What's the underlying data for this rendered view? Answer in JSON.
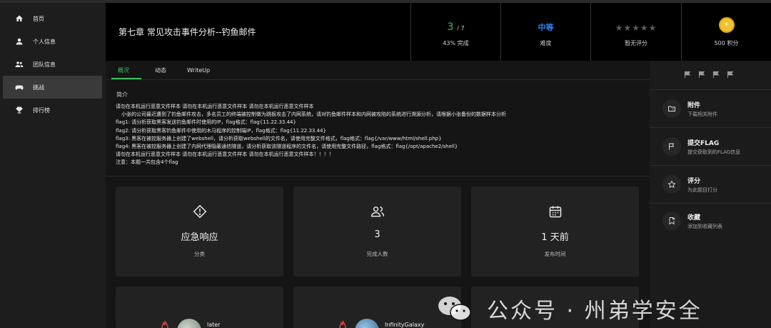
{
  "sidebar": {
    "items": [
      {
        "label": "首页",
        "icon": "home-icon"
      },
      {
        "label": "个人信息",
        "icon": "person-icon"
      },
      {
        "label": "团队信息",
        "icon": "group-icon"
      },
      {
        "label": "挑战",
        "icon": "gamepad-icon",
        "active": true
      },
      {
        "label": "排行榜",
        "icon": "trophy-icon"
      }
    ]
  },
  "header": {
    "title": "第七章 常见攻击事件分析--钓鱼邮件",
    "progress": {
      "solved": "3",
      "total": "/ 7",
      "label": "43% 完成"
    },
    "difficulty": {
      "value": "中等",
      "label": "难度"
    },
    "rating": {
      "stars": "★★★★★",
      "label": "暂无评分",
      "filled": 0
    },
    "points": {
      "label": "500 积分"
    }
  },
  "tabs": [
    "概况",
    "动态",
    "WriteUp"
  ],
  "description": {
    "title": "简介",
    "lines": [
      "请勿在本机运行恶意文件样本 请勿在本机运行恶意文件样本 请勿在本机运行恶意文件样本",
      "小张的公司最近遭到了钓鱼邮件攻击，多名员工的终端被控制做为跳板攻击了内网系统，请对钓鱼邮件样本和内网被攻陷的系统进行溯源分析，请根据小张备份的数据样本分析",
      "flag1: 请分析获取黑客发送钓鱼邮件时使用的IP，flag格式：flag{11.22.33.44}",
      "flag2: 请分析获取黑客钓鱼邮件中使用的木马程序的控制端IP，flag格式：flag{11.22.33.44}",
      "flag3: 黑客在被控服务器上创建了webshell，请分析获取webshell的文件名，请使用完整文件格式，flag格式：flag{/var/www/html/shell.php}",
      "flag4: 黑客在被控服务器上创建了内网代理隐蔽通信隧道，请分析获取该隧道程序的文件名，请使用完整文件路径，flag格式：flag{/opt/apache2/shell}",
      "请勿在本机运行恶意文件样本 请勿在本机运行恶意文件样本 请勿在本机运行恶意文件样本！！！！",
      "注意：本题一共包含4个flag"
    ]
  },
  "cards": [
    {
      "icon": "diamond-alert-icon",
      "value": "应急响应",
      "label": "分类"
    },
    {
      "icon": "users-icon",
      "value": "3",
      "label": "完成人数"
    },
    {
      "icon": "calendar-icon",
      "value": "1 天前",
      "label": "发布时间"
    }
  ],
  "solvers": [
    {
      "name": "later"
    },
    {
      "name": "InfinityGalaxy"
    }
  ],
  "actions": [
    {
      "title": "附件",
      "sub": "下载相关附件",
      "icon": "folder-icon"
    },
    {
      "title": "提交FLAG",
      "sub": "提交获取到的FLAG信息",
      "icon": "flag-icon"
    },
    {
      "title": "评分",
      "sub": "为此题目打分",
      "icon": "star-icon"
    },
    {
      "title": "收藏",
      "sub": "添加到收藏列表",
      "icon": "bookmark-icon"
    }
  ],
  "watermark": "公众号 · 州弟学安全",
  "colors": {
    "accent": "#3fbf5f",
    "difficulty": "#2f80ed",
    "coin": "#f2c230"
  }
}
